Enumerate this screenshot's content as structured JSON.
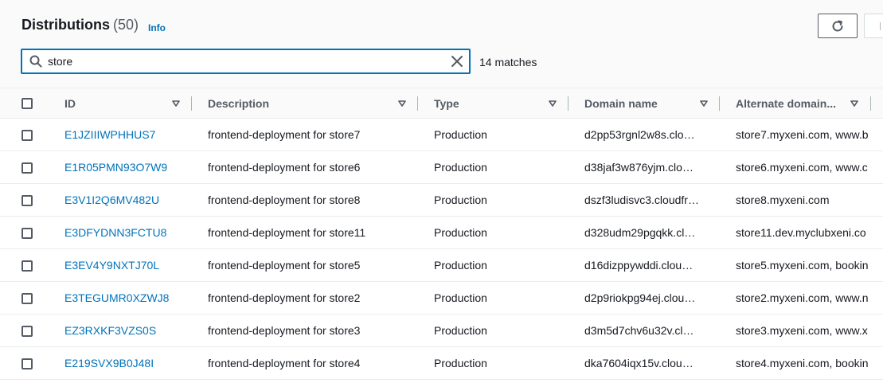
{
  "header": {
    "title": "Distributions",
    "count": "(50)",
    "info_link": "Info"
  },
  "toolbar": {
    "refresh_icon": "refresh-icon"
  },
  "search": {
    "value": "store",
    "placeholder": "",
    "matches": "14 matches"
  },
  "table": {
    "columns": [
      "ID",
      "Description",
      "Type",
      "Domain name",
      "Alternate domain..."
    ],
    "rows": [
      {
        "id": "E1JZIIIWPHHUS7",
        "description": "frontend-deployment for store7",
        "type": "Production",
        "domain": "d2pp53rgnl2w8s.clo…",
        "alternate": "store7.myxeni.com, www.b"
      },
      {
        "id": "E1R05PMN93O7W9",
        "description": "frontend-deployment for store6",
        "type": "Production",
        "domain": "d38jaf3w876yjm.clo…",
        "alternate": "store6.myxeni.com, www.c"
      },
      {
        "id": "E3V1I2Q6MV482U",
        "description": "frontend-deployment for store8",
        "type": "Production",
        "domain": "dszf3ludisvc3.cloudfr…",
        "alternate": "store8.myxeni.com"
      },
      {
        "id": "E3DFYDNN3FCTU8",
        "description": "frontend-deployment for store11",
        "type": "Production",
        "domain": "d328udm29pgqkk.cl…",
        "alternate": "store11.dev.myclubxeni.co"
      },
      {
        "id": "E3EV4Y9NXTJ70L",
        "description": "frontend-deployment for store5",
        "type": "Production",
        "domain": "d16dizppywddi.clou…",
        "alternate": "store5.myxeni.com, bookin"
      },
      {
        "id": "E3TEGUMR0XZWJ8",
        "description": "frontend-deployment for store2",
        "type": "Production",
        "domain": "d2p9riokpg94ej.clou…",
        "alternate": "store2.myxeni.com, www.n"
      },
      {
        "id": "EZ3RXKF3VZS0S",
        "description": "frontend-deployment for store3",
        "type": "Production",
        "domain": "d3m5d7chv6u32v.cl…",
        "alternate": "store3.myxeni.com, www.x"
      },
      {
        "id": "E219SVX9B0J48I",
        "description": "frontend-deployment for store4",
        "type": "Production",
        "domain": "dka7604iqx15v.clou…",
        "alternate": "store4.myxeni.com, bookin"
      }
    ]
  }
}
